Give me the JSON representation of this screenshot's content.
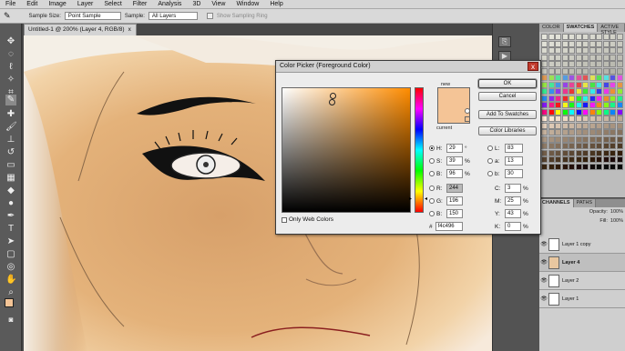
{
  "menubar": {
    "items": [
      "File",
      "Edit",
      "Image",
      "Layer",
      "Select",
      "Filter",
      "Analysis",
      "3D",
      "View",
      "Window",
      "Help"
    ]
  },
  "options": {
    "sample_size_label": "Sample Size:",
    "sample_size_value": "Point Sample",
    "sample_label": "Sample:",
    "sample_value": "All Layers",
    "sampling_ring": "Show Sampling Ring"
  },
  "document": {
    "tab_title": "Untitled-1 @ 200% (Layer 4, RGB/8)",
    "close": "x"
  },
  "swatch_tabs": [
    "COLOR",
    "SWATCHES",
    "ACTIVE STYLE"
  ],
  "layer_tabs": [
    "CHANNELS",
    "PATHS"
  ],
  "layer_opts": {
    "opacity_label": "Opacity:",
    "opacity_value": "100%",
    "fill_label": "Fill:",
    "fill_value": "100%"
  },
  "layers": [
    {
      "name": "Layer 1 copy"
    },
    {
      "name": "Layer 4"
    },
    {
      "name": "Layer 2"
    },
    {
      "name": "Layer 1"
    }
  ],
  "dialog": {
    "title": "Color Picker (Foreground Color)",
    "close": "x",
    "new_label": "new",
    "current_label": "current",
    "new_color": "#f4c496",
    "current_color": "#f4c496",
    "buttons": {
      "ok": "OK",
      "cancel": "Cancel",
      "add_swatches": "Add To Swatches",
      "libraries": "Color Libraries"
    },
    "hsb": [
      {
        "k": "H:",
        "v": "29",
        "u": "°",
        "on": true
      },
      {
        "k": "S:",
        "v": "39",
        "u": "%",
        "on": false
      },
      {
        "k": "B:",
        "v": "96",
        "u": "%",
        "on": false
      }
    ],
    "rgb": [
      {
        "k": "R:",
        "v": "244"
      },
      {
        "k": "G:",
        "v": "196"
      },
      {
        "k": "B:",
        "v": "150"
      }
    ],
    "lab": [
      {
        "k": "L:",
        "v": "83"
      },
      {
        "k": "a:",
        "v": "13"
      },
      {
        "k": "b:",
        "v": "30"
      }
    ],
    "cmyk": [
      {
        "k": "C:",
        "v": "3",
        "u": "%"
      },
      {
        "k": "M:",
        "v": "25",
        "u": "%"
      },
      {
        "k": "Y:",
        "v": "43",
        "u": "%"
      },
      {
        "k": "K:",
        "v": "0",
        "u": "%"
      }
    ],
    "web_colors": "Only Web Colors",
    "hex_label": "#",
    "hex_value": "f4c496"
  }
}
